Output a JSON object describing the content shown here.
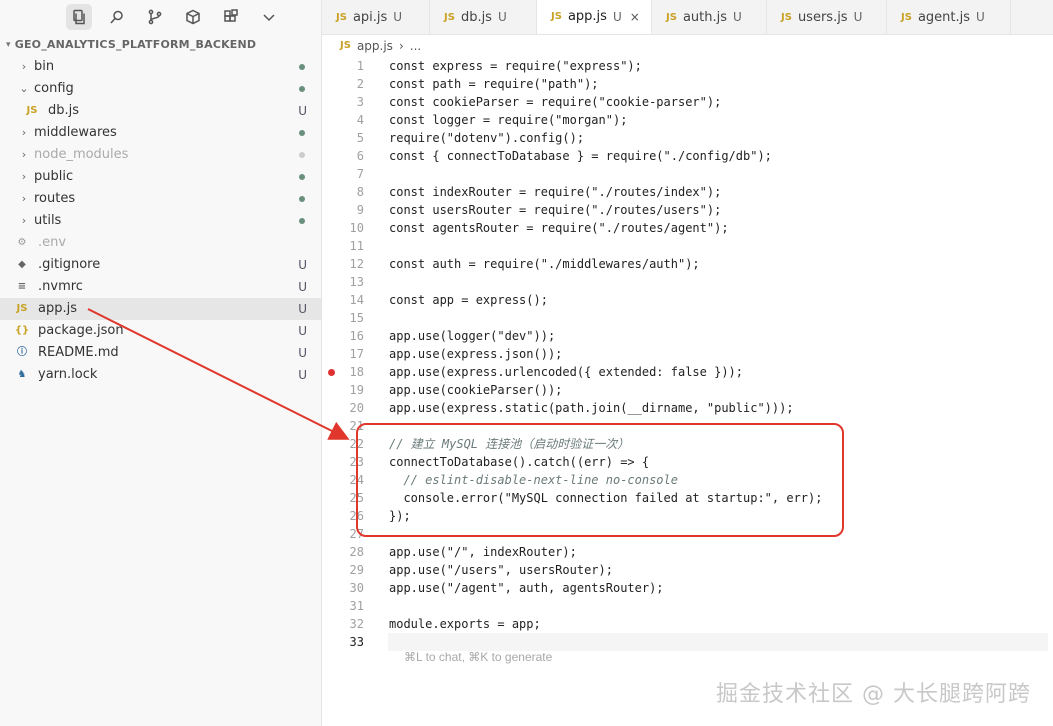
{
  "explorer": {
    "project_title": "GEO_ANALYTICS_PLATFORM_BACKEND",
    "items": [
      {
        "label": "bin",
        "kind": "folder"
      },
      {
        "label": "config",
        "kind": "folder-open"
      },
      {
        "label": "db.js",
        "kind": "file-js",
        "badge": "U"
      },
      {
        "label": "middlewares",
        "kind": "folder"
      },
      {
        "label": "node_modules",
        "kind": "folder"
      },
      {
        "label": "public",
        "kind": "folder"
      },
      {
        "label": "routes",
        "kind": "folder"
      },
      {
        "label": "utils",
        "kind": "folder"
      },
      {
        "label": ".env",
        "kind": "file-env"
      },
      {
        "label": ".gitignore",
        "kind": "file-git",
        "badge": "U"
      },
      {
        "label": ".nvmrc",
        "kind": "file-text",
        "badge": "U"
      },
      {
        "label": "app.js",
        "kind": "file-js",
        "badge": "U"
      },
      {
        "label": "package.json",
        "kind": "file-json",
        "badge": "U"
      },
      {
        "label": "README.md",
        "kind": "file-info",
        "badge": "U"
      },
      {
        "label": "yarn.lock",
        "kind": "file-yarn",
        "badge": "U"
      }
    ]
  },
  "tabs": [
    {
      "label": "api.js",
      "status": "U"
    },
    {
      "label": "db.js",
      "status": "U"
    },
    {
      "label": "app.js",
      "status": "U"
    },
    {
      "label": "auth.js",
      "status": "U"
    },
    {
      "label": "users.js",
      "status": "U"
    },
    {
      "label": "agent.js",
      "status": "U"
    }
  ],
  "breadcrumb": {
    "file": "app.js",
    "more": "..."
  },
  "file_type_label": "JS",
  "close_glyph": "×",
  "editor": {
    "lines": [
      {
        "n": "1",
        "text": "const express = require(\"express\");"
      },
      {
        "n": "2",
        "text": "const path = require(\"path\");"
      },
      {
        "n": "3",
        "text": "const cookieParser = require(\"cookie-parser\");"
      },
      {
        "n": "4",
        "text": "const logger = require(\"morgan\");"
      },
      {
        "n": "5",
        "text": "require(\"dotenv\").config();"
      },
      {
        "n": "6",
        "text": "const { connectToDatabase } = require(\"./config/db\");"
      },
      {
        "n": "7",
        "text": ""
      },
      {
        "n": "8",
        "text": "const indexRouter = require(\"./routes/index\");"
      },
      {
        "n": "9",
        "text": "const usersRouter = require(\"./routes/users\");"
      },
      {
        "n": "10",
        "text": "const agentsRouter = require(\"./routes/agent\");"
      },
      {
        "n": "11",
        "text": ""
      },
      {
        "n": "12",
        "text": "const auth = require(\"./middlewares/auth\");"
      },
      {
        "n": "13",
        "text": ""
      },
      {
        "n": "14",
        "text": "const app = express();"
      },
      {
        "n": "15",
        "text": ""
      },
      {
        "n": "16",
        "text": "app.use(logger(\"dev\"));"
      },
      {
        "n": "17",
        "text": "app.use(express.json());"
      },
      {
        "n": "18",
        "text": "app.use(express.urlencoded({ extended: false }));"
      },
      {
        "n": "19",
        "text": "app.use(cookieParser());"
      },
      {
        "n": "20",
        "text": "app.use(express.static(path.join(__dirname, \"public\")));"
      },
      {
        "n": "21",
        "text": ""
      },
      {
        "n": "22",
        "text": "// 建立 MySQL 连接池（启动时验证一次）"
      },
      {
        "n": "23",
        "text": "connectToDatabase().catch((err) => {"
      },
      {
        "n": "24",
        "text": "  // eslint-disable-next-line no-console"
      },
      {
        "n": "25",
        "text": "  console.error(\"MySQL connection failed at startup:\", err);"
      },
      {
        "n": "26",
        "text": "});"
      },
      {
        "n": "27",
        "text": ""
      },
      {
        "n": "28",
        "text": "app.use(\"/\", indexRouter);"
      },
      {
        "n": "29",
        "text": "app.use(\"/users\", usersRouter);"
      },
      {
        "n": "30",
        "text": "app.use(\"/agent\", auth, agentsRouter);"
      },
      {
        "n": "31",
        "text": ""
      },
      {
        "n": "32",
        "text": "module.exports = app;"
      },
      {
        "n": "33",
        "text": ""
      }
    ],
    "breakpoint_line": "18",
    "current_line": "33",
    "inline_hint": "⌘L to chat, ⌘K to generate"
  },
  "watermark": "掘金技术社区 @ 大长腿跨阿跨",
  "colors": {
    "annotation": "#e0362c",
    "breakpoint": "#e03030"
  }
}
